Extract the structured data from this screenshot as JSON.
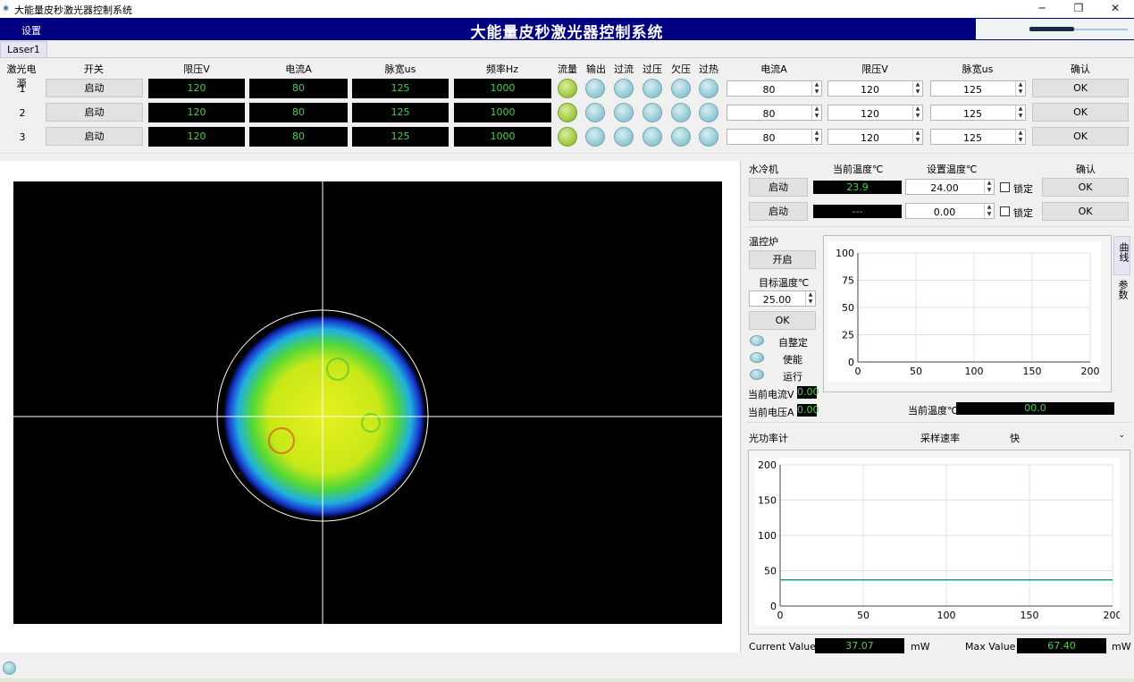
{
  "window": {
    "title": "大能量皮秒激光器控制系统",
    "controls": [
      "─",
      "❐",
      "✕"
    ]
  },
  "menu": {
    "settings": "设置",
    "header_title": "大能量皮秒激光器控制系统"
  },
  "tabs": [
    "Laser1"
  ],
  "laser_table": {
    "headers": [
      "激光电源",
      "开关",
      "限压V",
      "电流A",
      "脉宽us",
      "频率Hz",
      "流量",
      "输出",
      "过流",
      "过压",
      "欠压",
      "过热",
      "电流A",
      "限压V",
      "脉宽us",
      "确认"
    ],
    "rows": [
      {
        "index": "1",
        "switch": "启动",
        "voltage": "120",
        "current": "80",
        "pulse": "125",
        "freq": "1000",
        "leds": [
          "green",
          "blue",
          "blue",
          "blue",
          "blue",
          "blue"
        ],
        "set_current": "80",
        "set_voltage": "120",
        "set_pulse": "125",
        "ok": "OK"
      },
      {
        "index": "2",
        "switch": "启动",
        "voltage": "120",
        "current": "80",
        "pulse": "125",
        "freq": "1000",
        "leds": [
          "green",
          "blue",
          "blue",
          "blue",
          "blue",
          "blue"
        ],
        "set_current": "80",
        "set_voltage": "120",
        "set_pulse": "125",
        "ok": "OK"
      },
      {
        "index": "3",
        "switch": "启动",
        "voltage": "120",
        "current": "80",
        "pulse": "125",
        "freq": "1000",
        "leds": [
          "green",
          "blue",
          "blue",
          "blue",
          "blue",
          "blue"
        ],
        "set_current": "80",
        "set_voltage": "120",
        "set_pulse": "125",
        "ok": "OK"
      }
    ]
  },
  "chiller": {
    "title": "水冷机",
    "h_current": "当前温度℃",
    "h_set": "设置温度℃",
    "h_confirm": "确认",
    "rows": [
      {
        "start": "启动",
        "current": "23.9",
        "set": "24.00",
        "lock": "锁定",
        "ok": "OK"
      },
      {
        "start": "启动",
        "current": "---",
        "set": "0.00",
        "lock": "锁定",
        "ok": "OK"
      }
    ]
  },
  "oven": {
    "title": "温控炉",
    "open": "开启",
    "target_label": "目标温度℃",
    "target": "25.00",
    "ok": "OK",
    "statuses": [
      "自整定",
      "使能",
      "运行"
    ],
    "cur_v_label": "当前电流V",
    "cur_v": "0.00",
    "cur_a_label": "当前电压A",
    "cur_a": "0.00",
    "cur_temp_label": "当前温度℃",
    "cur_temp": "00.0",
    "side_tabs": [
      "曲线",
      "参数"
    ]
  },
  "power_meter": {
    "title": "光功率计",
    "rate_label": "采样速率",
    "rate": "快",
    "current_label": "Current Value",
    "current": "37.07",
    "unit": "mW",
    "max_label": "Max Value",
    "max": "67.40"
  },
  "chart_data": [
    {
      "type": "line",
      "title": "",
      "x": [],
      "values": [],
      "xlim": [
        0,
        200
      ],
      "ylim": [
        0,
        100
      ],
      "xticks": [
        "0",
        "50",
        "100",
        "150",
        "200"
      ],
      "yticks": [
        "0",
        "25",
        "50",
        "75",
        "100"
      ],
      "grid": true
    },
    {
      "type": "line",
      "title": "",
      "x": [
        0,
        200
      ],
      "series": [
        {
          "values": [
            37.07,
            37.07
          ],
          "color": "#1f9a8a"
        }
      ],
      "xlim": [
        0,
        200
      ],
      "ylim": [
        0,
        200
      ],
      "xticks": [
        "0",
        "50",
        "100",
        "150",
        "200"
      ],
      "yticks": [
        "0",
        "50",
        "100",
        "150",
        "200"
      ],
      "grid": true
    }
  ]
}
